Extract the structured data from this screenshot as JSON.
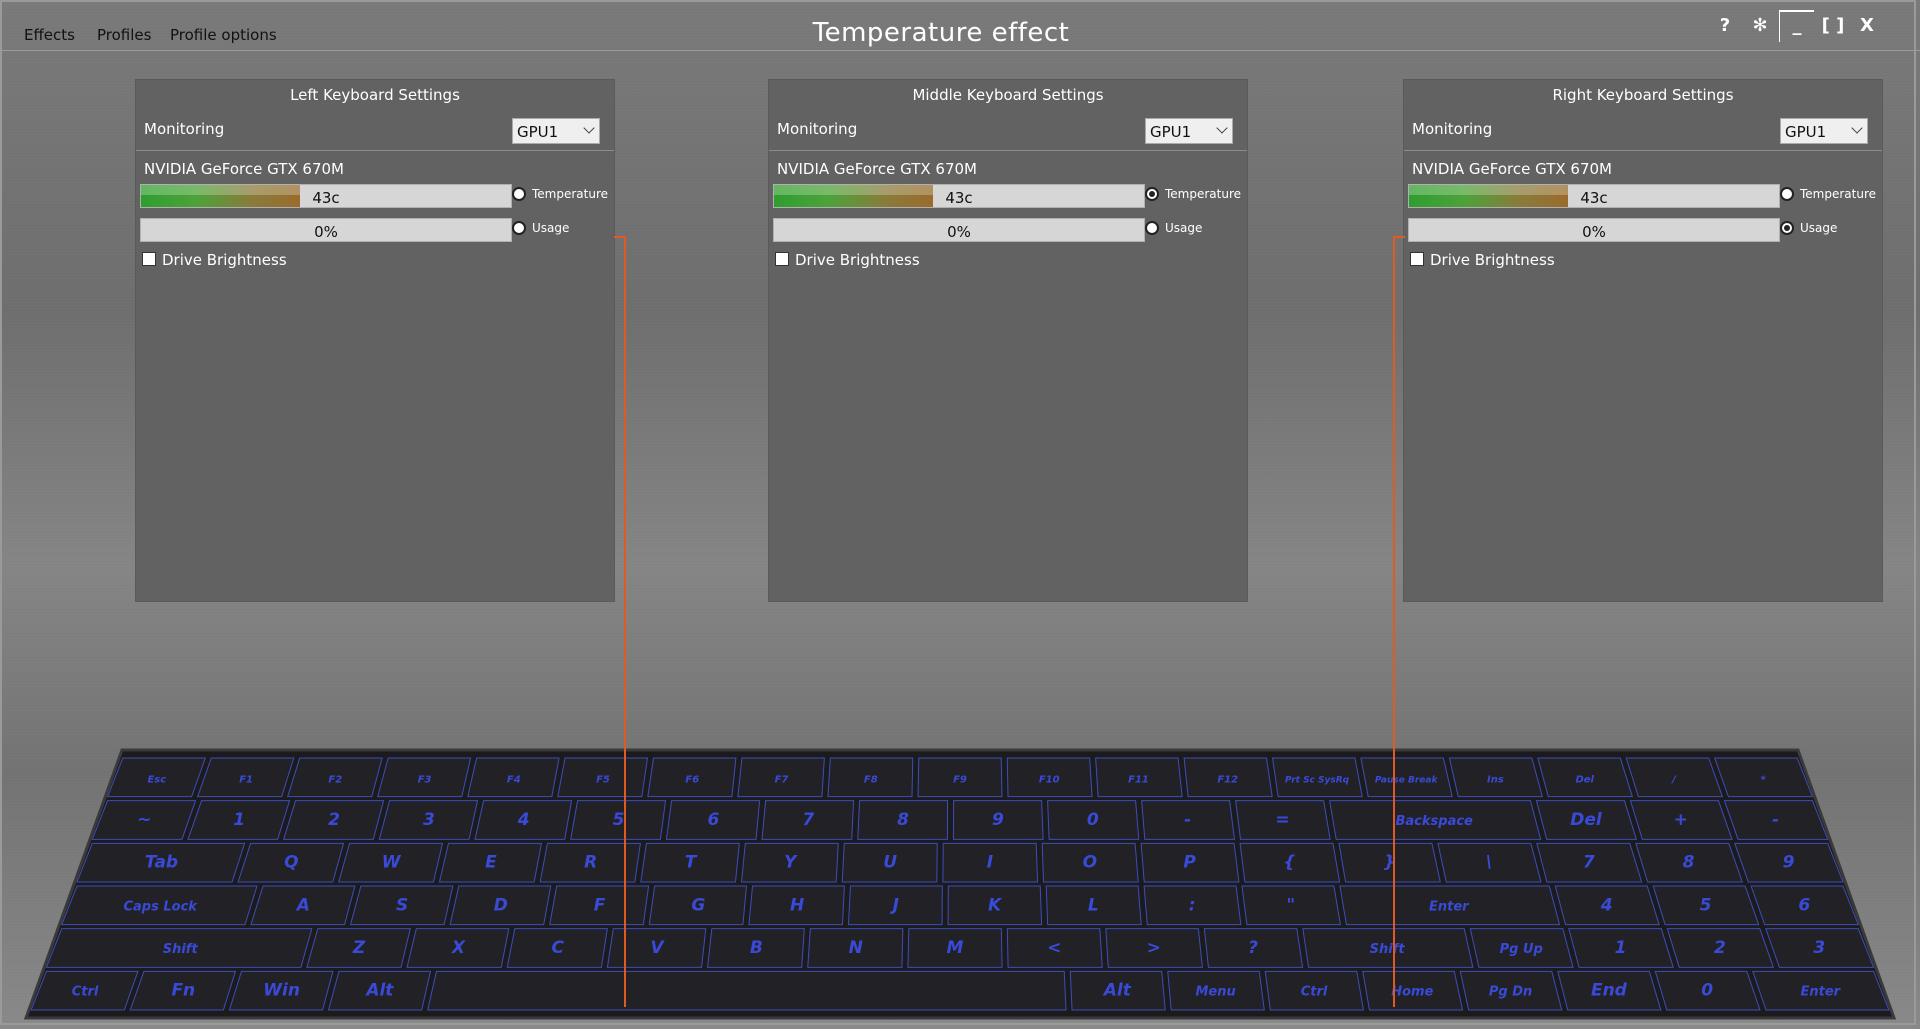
{
  "menu": [
    "Effects",
    "Profiles",
    "Profile options"
  ],
  "title": "Temperature effect",
  "window_buttons": {
    "help": "?",
    "settings": "✻",
    "minimize": "_",
    "maximize": "[ ]",
    "close": "X"
  },
  "panels": [
    {
      "title": "Left Keyboard Settings",
      "monitoring_label": "Monitoring",
      "selected": "GPU1",
      "gpu_name": "NVIDIA GeForce GTX 670M",
      "temp_value": "43c",
      "temp_level": 43,
      "usage_value": "0%",
      "usage_level": 0,
      "temp_label": "Temperature",
      "usage_label": "Usage",
      "selected_metric": "none",
      "drive_brightness_label": "Drive Brightness",
      "drive_brightness_checked": false
    },
    {
      "title": "Middle Keyboard Settings",
      "monitoring_label": "Monitoring",
      "selected": "GPU1",
      "gpu_name": "NVIDIA GeForce GTX 670M",
      "temp_value": "43c",
      "temp_level": 43,
      "usage_value": "0%",
      "usage_level": 0,
      "temp_label": "Temperature",
      "usage_label": "Usage",
      "selected_metric": "temperature",
      "drive_brightness_label": "Drive Brightness",
      "drive_brightness_checked": false
    },
    {
      "title": "Right Keyboard Settings",
      "monitoring_label": "Monitoring",
      "selected": "GPU1",
      "gpu_name": "NVIDIA GeForce GTX 670M",
      "temp_value": "43c",
      "temp_level": 43,
      "usage_value": "0%",
      "usage_level": 0,
      "temp_label": "Temperature",
      "usage_label": "Usage",
      "selected_metric": "usage",
      "drive_brightness_label": "Drive Brightness",
      "drive_brightness_checked": false
    }
  ],
  "keyboard": {
    "rows": [
      [
        "Esc",
        "F1",
        "F2",
        "F3",
        "F4",
        "F5",
        "F6",
        "F7",
        "F8",
        "F9",
        "F10",
        "F11",
        "F12",
        "Prt Sc SysRq",
        "Pause Break",
        "Ins",
        "Del",
        "/",
        "*"
      ],
      [
        "~",
        "1",
        "2",
        "3",
        "4",
        "5",
        "6",
        "7",
        "8",
        "9",
        "0",
        "-",
        "=",
        "Backspace",
        "Del",
        "+",
        "-"
      ],
      [
        "Tab",
        "Q",
        "W",
        "E",
        "R",
        "T",
        "Y",
        "U",
        "I",
        "O",
        "P",
        "{",
        "}",
        "\\",
        "7",
        "8",
        "9"
      ],
      [
        "Caps Lock",
        "A",
        "S",
        "D",
        "F",
        "G",
        "H",
        "J",
        "K",
        "L",
        ":",
        "\"",
        "Enter",
        "4",
        "5",
        "6"
      ],
      [
        "Shift",
        "Z",
        "X",
        "C",
        "V",
        "B",
        "N",
        "M",
        "<",
        ">",
        "?",
        "Shift",
        "Pg Up",
        "1",
        "2",
        "3"
      ],
      [
        "Ctrl",
        "Fn",
        "Win",
        "Alt",
        "",
        "Alt",
        "Menu",
        "Ctrl",
        "Home",
        "Pg Dn",
        "End",
        "0",
        "Enter"
      ]
    ]
  },
  "colors": {
    "key_glyph": "#3a4ad8",
    "marker_line": "#e05a24",
    "bar_fill_start": "#2f9e2f",
    "bar_fill_end": "#9a6b2c"
  }
}
